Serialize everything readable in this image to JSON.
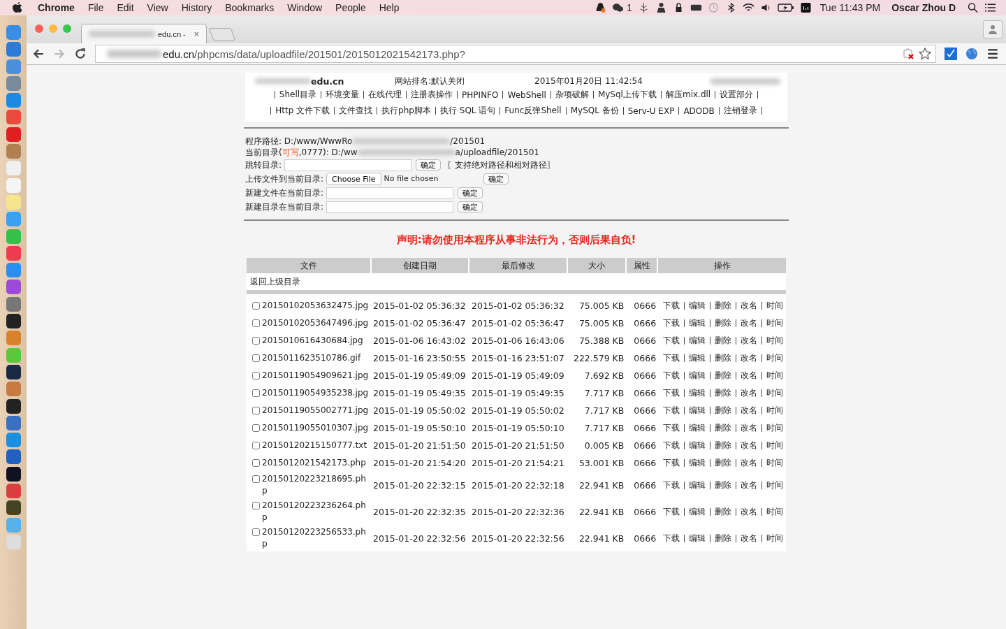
{
  "menu_bar": {
    "app": "Chrome",
    "menus": [
      "File",
      "Edit",
      "View",
      "History",
      "Bookmarks",
      "Window",
      "People",
      "Help"
    ],
    "chat_count": "1",
    "clock": "Tue 11:43 PM",
    "user": "Oscar Zhou D"
  },
  "browser": {
    "tab_title": "edu.cn -",
    "tab_close": "×",
    "url_host": "edu.cn",
    "url_path": "/phpcms/data/uploadfile/201501/2015012021542173.php?"
  },
  "header": {
    "site": "edu.cn",
    "rank": "网站排名:默认关闭",
    "datetime": "2015年01月20日 11:42:54"
  },
  "nav": [
    [
      "Shell目录",
      "环境变量",
      "在线代理",
      "注册表操作",
      "PHPINFO",
      "WebShell",
      "杂项破解",
      "MySql上传下载",
      "解压mix.dll",
      "设置部分"
    ],
    [
      "Http 文件下载",
      "文件查找",
      "执行php脚本",
      "执行 SQL 语句",
      "Func反弹Shell",
      "MySQL 备份",
      "Serv-U EXP",
      "ADODB",
      "注销登录"
    ]
  ],
  "paths": [
    [
      {
        "kind": "plain",
        "text": "程序路径: D:/www/WwwRo"
      },
      {
        "kind": "blur"
      },
      {
        "kind": "plain",
        "text": "/201501"
      }
    ],
    [
      {
        "kind": "plain",
        "text": "当前目录("
      },
      {
        "kind": "warn",
        "text": "可写"
      },
      {
        "kind": "plain",
        "text": ",0777): D:/ww"
      },
      {
        "kind": "blur"
      },
      {
        "kind": "plain",
        "text": "a/uploadfile/201501"
      }
    ]
  ],
  "forms": [
    {
      "kind": "input",
      "label": "跳转目录:",
      "button": "确定",
      "hint": "〖支持绝对路径和相对路径〗"
    },
    {
      "kind": "upload",
      "label": "上传文件到当前目录:",
      "choose": "Choose File",
      "status": "No file chosen",
      "button": "确定"
    },
    {
      "kind": "input",
      "label": "新建文件在当前目录:",
      "button": "确定"
    },
    {
      "kind": "input",
      "label": "新建目录在当前目录:",
      "button": "确定"
    }
  ],
  "warning": "声明:请勿使用本程序从事非法行为，否则后果自负!",
  "table": {
    "columns": [
      "文件",
      "创建日期",
      "最后修改",
      "大小",
      "属性",
      "操作"
    ],
    "parent_link": "返回上级目录",
    "rows": [
      {
        "name": "20150102053632475.jpg",
        "created": "2015-01-02 05:36:32",
        "modified": "2015-01-02 05:36:32",
        "size": "75.005 KB",
        "perm": "0666",
        "checked": false,
        "actions": [
          "下载",
          "编辑",
          "删除",
          "改名",
          "时间"
        ]
      },
      {
        "name": "20150102053647496.jpg",
        "created": "2015-01-02 05:36:47",
        "modified": "2015-01-02 05:36:47",
        "size": "75.005 KB",
        "perm": "0666",
        "checked": false,
        "actions": [
          "下载",
          "编辑",
          "删除",
          "改名",
          "时间"
        ]
      },
      {
        "name": "2015010616430684.jpg",
        "created": "2015-01-06 16:43:02",
        "modified": "2015-01-06 16:43:06",
        "size": "75.388 KB",
        "perm": "0666",
        "checked": false,
        "actions": [
          "下载",
          "编辑",
          "删除",
          "改名",
          "时间"
        ]
      },
      {
        "name": "2015011623510786.gif",
        "created": "2015-01-16 23:50:55",
        "modified": "2015-01-16 23:51:07",
        "size": "222.579 KB",
        "perm": "0666",
        "checked": false,
        "actions": [
          "下载",
          "编辑",
          "删除",
          "改名",
          "时间"
        ]
      },
      {
        "name": "20150119054909621.jpg",
        "created": "2015-01-19 05:49:09",
        "modified": "2015-01-19 05:49:09",
        "size": "7.692 KB",
        "perm": "0666",
        "checked": false,
        "actions": [
          "下载",
          "编辑",
          "删除",
          "改名",
          "时间"
        ]
      },
      {
        "name": "20150119054935238.jpg",
        "created": "2015-01-19 05:49:35",
        "modified": "2015-01-19 05:49:35",
        "size": "7.717 KB",
        "perm": "0666",
        "checked": false,
        "actions": [
          "下载",
          "编辑",
          "删除",
          "改名",
          "时间"
        ]
      },
      {
        "name": "20150119055002771.jpg",
        "created": "2015-01-19 05:50:02",
        "modified": "2015-01-19 05:50:02",
        "size": "7.717 KB",
        "perm": "0666",
        "checked": false,
        "actions": [
          "下载",
          "编辑",
          "删除",
          "改名",
          "时间"
        ]
      },
      {
        "name": "20150119055010307.jpg",
        "created": "2015-01-19 05:50:10",
        "modified": "2015-01-19 05:50:10",
        "size": "7.717 KB",
        "perm": "0666",
        "checked": false,
        "actions": [
          "下载",
          "编辑",
          "删除",
          "改名",
          "时间"
        ]
      },
      {
        "name": "20150120215150777.txt",
        "created": "2015-01-20 21:51:50",
        "modified": "2015-01-20 21:51:50",
        "size": "0.005 KB",
        "perm": "0666",
        "checked": false,
        "actions": [
          "下载",
          "编辑",
          "删除",
          "改名",
          "时间"
        ]
      },
      {
        "name": "2015012021542173.php",
        "created": "2015-01-20 21:54:20",
        "modified": "2015-01-20 21:54:21",
        "size": "53.001 KB",
        "perm": "0666",
        "checked": false,
        "actions": [
          "下载",
          "编辑",
          "删除",
          "改名",
          "时间"
        ]
      },
      {
        "name": "20150120223218695.php",
        "created": "2015-01-20 22:32:15",
        "modified": "2015-01-20 22:32:18",
        "size": "22.941 KB",
        "perm": "0666",
        "checked": false,
        "actions": [
          "下载",
          "编辑",
          "删除",
          "改名",
          "时间"
        ]
      },
      {
        "name": "20150120223236264.php",
        "created": "2015-01-20 22:32:35",
        "modified": "2015-01-20 22:32:36",
        "size": "22.941 KB",
        "perm": "0666",
        "checked": false,
        "actions": [
          "下载",
          "编辑",
          "删除",
          "改名",
          "时间"
        ]
      },
      {
        "name": "20150120223256533.php",
        "created": "2015-01-20 22:32:56",
        "modified": "2015-01-20 22:32:56",
        "size": "22.941 KB",
        "perm": "0666",
        "checked": false,
        "actions": [
          "下载",
          "编辑",
          "删除",
          "改名",
          "时间"
        ]
      }
    ]
  }
}
